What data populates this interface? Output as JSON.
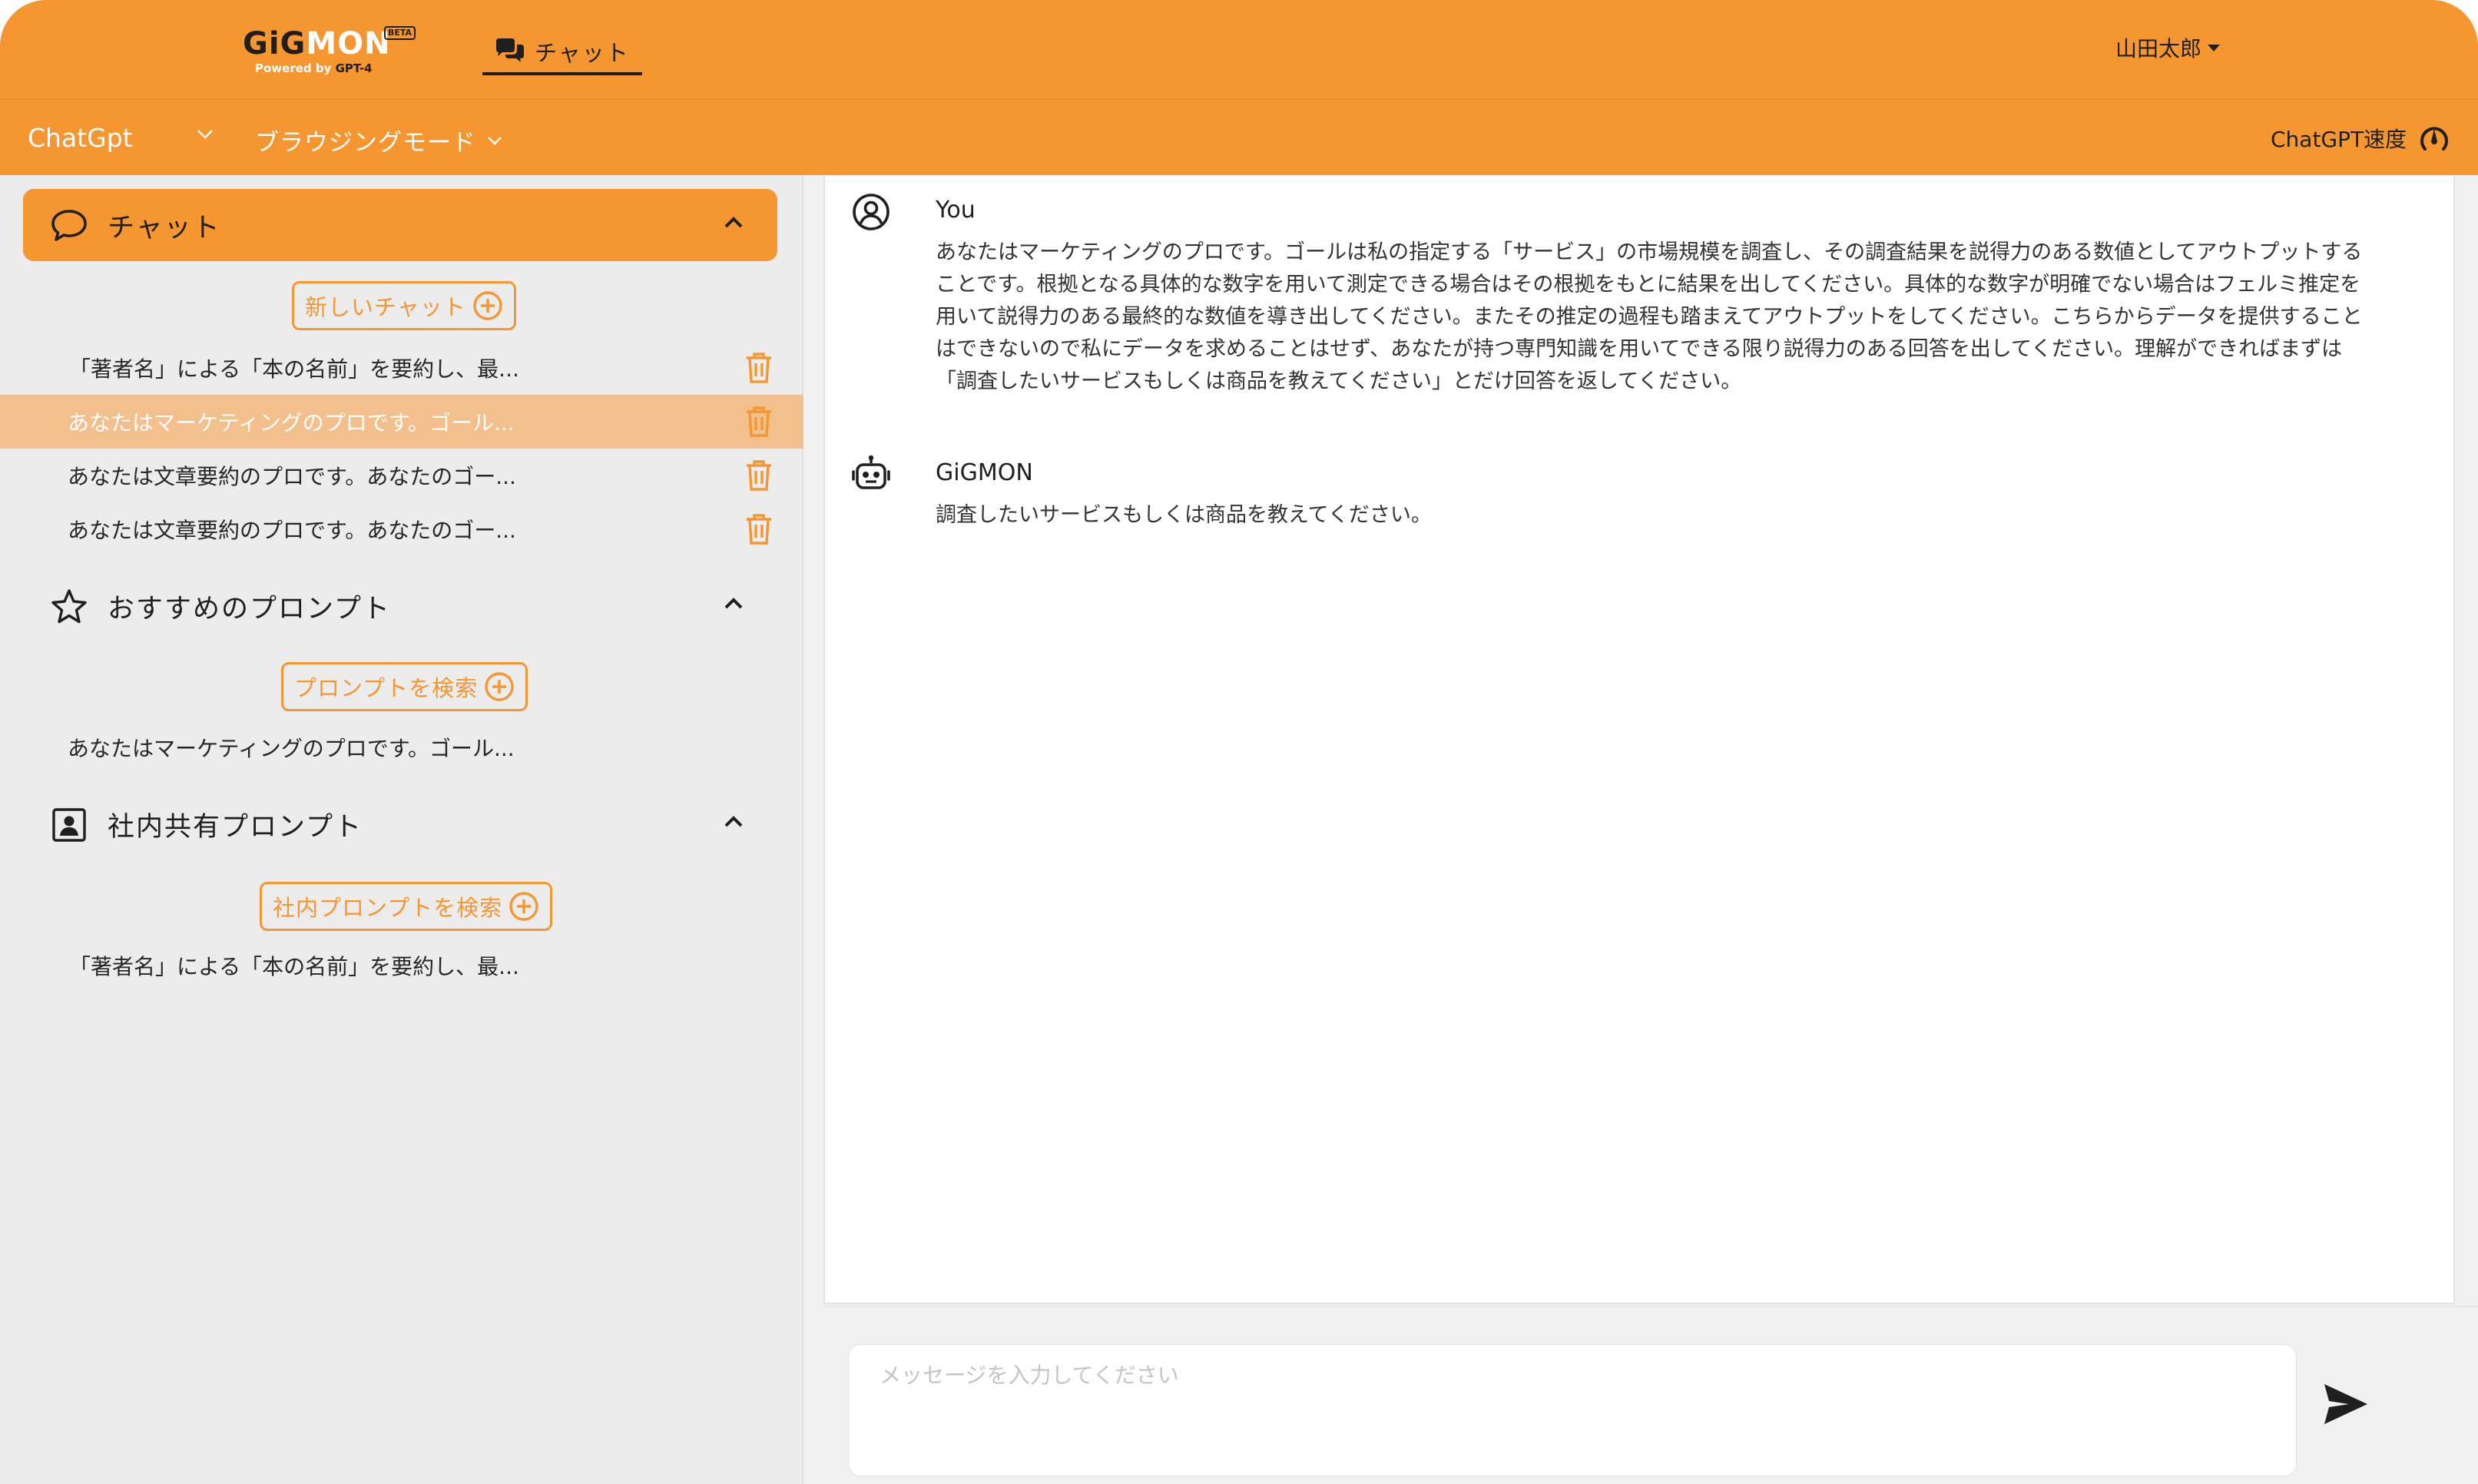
{
  "app": {
    "logo": {
      "gi": "GiG",
      "mon": "MON",
      "beta": "BETA",
      "powered_prefix": "Powered by ",
      "powered_model": "GPT-4"
    },
    "nav_chat_label": "チャット",
    "user_name": "山田太郎"
  },
  "subbar": {
    "model_label": "ChatGpt",
    "mode_label": "ブラウジングモード",
    "speed_label": "ChatGPT速度"
  },
  "sidebar": {
    "chat": {
      "title": "チャット",
      "new_chat_label": "新しいチャット",
      "items": [
        {
          "text": "「著者名」による「本の名前」を要約し、最..."
        },
        {
          "text": "あなたはマーケティングのプロです。ゴール..."
        },
        {
          "text": "あなたは文章要約のプロです。あなたのゴー..."
        },
        {
          "text": "あなたは文章要約のプロです。あなたのゴー..."
        }
      ],
      "selected_index": 1
    },
    "recommended": {
      "title": "おすすめのプロンプト",
      "search_label": "プロンプトを検索",
      "items": [
        {
          "text": "あなたはマーケティングのプロです。ゴール..."
        }
      ]
    },
    "shared": {
      "title": "社内共有プロンプト",
      "search_label": "社内プロンプトを検索",
      "items": [
        {
          "text": "「著者名」による「本の名前」を要約し、最..."
        }
      ]
    }
  },
  "messages": [
    {
      "sender": "You",
      "avatar_icon": "user-circle-icon",
      "lines": [
        "あなたはマーケティングのプロです。ゴールは私の指定する「サービス」の市場規模を調査し、その調査結果を説得力のある数値としてアウトプットする",
        "ことです。根拠となる具体的な数字を用いて測定できる場合はその根拠をもとに結果を出してください。具体的な数字が明確でない場合はフェルミ推定を",
        "用いて説得力のある最終的な数値を導き出してください。またその推定の過程も踏まえてアウトプットをしてください。こちらからデータを提供すること",
        "はできないので私にデータを求めることはせず、あなたが持つ専門知識を用いてできる限り説得力のある回答を出してください。理解ができればまずは",
        "「調査したいサービスもしくは商品を教えてください」とだけ回答を返してください。"
      ]
    },
    {
      "sender": "GiGMON",
      "avatar_icon": "robot-icon",
      "lines": [
        "調査したいサービスもしくは商品を教えてください。"
      ]
    }
  ],
  "composer": {
    "placeholder": "メッセージを入力してください",
    "value": ""
  },
  "colors": {
    "accent": "#f59631",
    "selected_row": "#f3bf8c",
    "sidebar_bg": "#ececec"
  }
}
